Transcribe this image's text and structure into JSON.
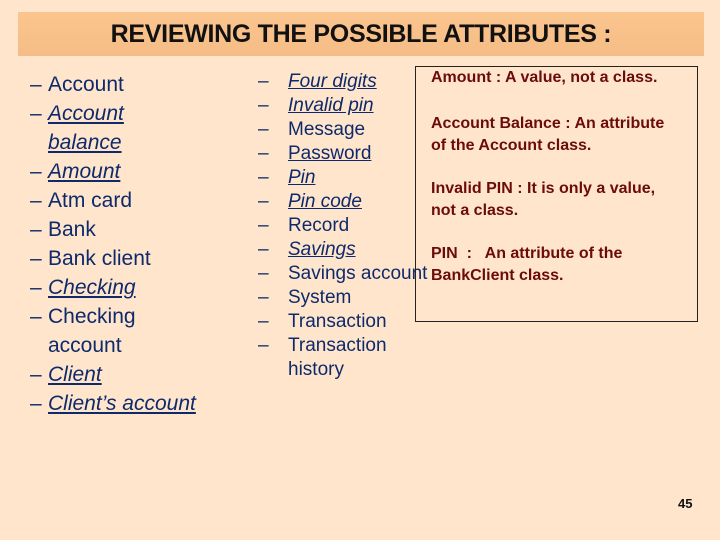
{
  "title": "REVIEWING THE POSSIBLE ATTRIBUTES :",
  "left_list": [
    {
      "dash": "–",
      "lines": [
        "Account"
      ],
      "style": "plain"
    },
    {
      "dash": "–",
      "lines": [
        "Account",
        "balance"
      ],
      "style": "italic-underline"
    },
    {
      "dash": "–",
      "lines": [
        "Amount"
      ],
      "style": "italic-underline"
    },
    {
      "dash": "–",
      "lines": [
        "Atm card"
      ],
      "style": "plain"
    },
    {
      "dash": "–",
      "lines": [
        "Bank"
      ],
      "style": "plain"
    },
    {
      "dash": "–",
      "lines": [
        "Bank client"
      ],
      "style": "plain"
    },
    {
      "dash": "–",
      "lines": [
        "Checking"
      ],
      "style": "italic-underline"
    },
    {
      "dash": "–",
      "lines": [
        "Checking",
        "account"
      ],
      "style": "plain"
    },
    {
      "dash": "–",
      "lines": [
        "Client"
      ],
      "style": "italic-underline"
    },
    {
      "dash": "–",
      "lines": [
        "Client’s account"
      ],
      "style": "italic-underline"
    }
  ],
  "mid_list": [
    {
      "dash": "–",
      "lines": [
        "Four digits"
      ],
      "style": "italic-underline"
    },
    {
      "dash": "–",
      "lines": [
        "Invalid pin"
      ],
      "style": "italic-underline"
    },
    {
      "dash": "–",
      "lines": [
        "Message"
      ],
      "style": "plain"
    },
    {
      "dash": "–",
      "lines": [
        "Password"
      ],
      "style": "underline"
    },
    {
      "dash": "–",
      "lines": [
        "Pin"
      ],
      "style": "italic-underline"
    },
    {
      "dash": "–",
      "lines": [
        "Pin code"
      ],
      "style": "italic-underline"
    },
    {
      "dash": "–",
      "lines": [
        "Record"
      ],
      "style": "plain"
    },
    {
      "dash": "–",
      "lines": [
        "Savings"
      ],
      "style": "italic-underline"
    },
    {
      "dash": "–",
      "lines": [
        "Savings account"
      ],
      "style": "plain"
    },
    {
      "dash": "–",
      "lines": [
        "System"
      ],
      "style": "plain"
    },
    {
      "dash": "–",
      "lines": [
        "Transaction"
      ],
      "style": "plain"
    },
    {
      "dash": "–",
      "lines": [
        "Transaction",
        "history"
      ],
      "style": "plain"
    }
  ],
  "notes": {
    "amount": "Amount : A value, not a class.",
    "account_balance": "Account Balance : An attribute\nof the Account class.",
    "invalid_pin": "Invalid PIN : It is only a value,\nnot a class.",
    "pin": "PIN  :   An attribute of the\nBankClient class."
  },
  "page_number": "45",
  "colors": {
    "background": "#fee5cc",
    "title_bar": "#f8c089",
    "list_text": "#0e2a6b",
    "note_text": "#6b0b0b"
  }
}
